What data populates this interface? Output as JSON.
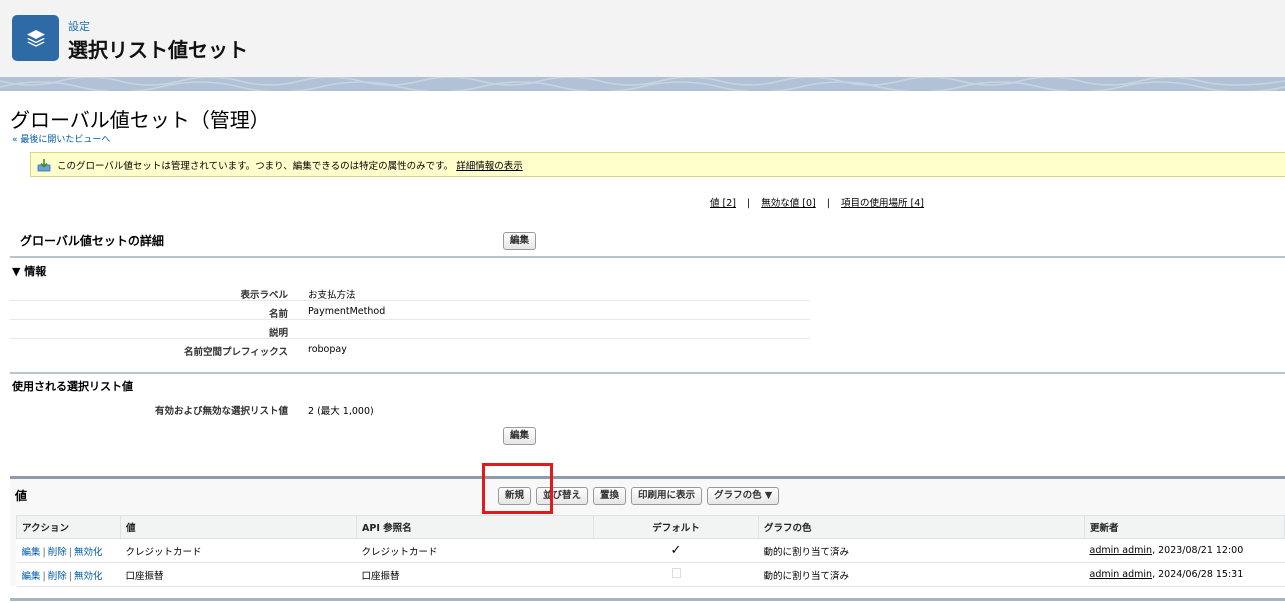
{
  "header": {
    "subtitle": "設定",
    "title": "選択リスト値セット",
    "icon": "stack-layers-icon"
  },
  "page": {
    "title": "グローバル値セット（管理）",
    "back_link": "« 最後に開いたビューへ"
  },
  "info_bar": {
    "text": "このグローバル値セットは管理されています。つまり、編集できるのは特定の属性のみです。",
    "link": "詳細情報の表示"
  },
  "related_links": [
    {
      "label": "値 [2]"
    },
    {
      "label": "無効な値 [0]"
    },
    {
      "label": "項目の使用場所 [4]"
    }
  ],
  "related_sep": "|",
  "detail": {
    "heading": "グローバル値セットの詳細",
    "edit_label": "編集",
    "section_label": "▼ 情報",
    "fields": [
      {
        "label": "表示ラベル",
        "value": "お支払方法"
      },
      {
        "label": "名前",
        "value": "PaymentMethod"
      },
      {
        "label": "説明",
        "value": ""
      },
      {
        "label": "名前空間プレフィックス",
        "value": "robopay"
      }
    ]
  },
  "used": {
    "heading": "使用される選択リスト値",
    "label": "有効および無効な選択リスト値",
    "value": "2 (最大 1,000)",
    "edit_label": "編集"
  },
  "values": {
    "title": "値",
    "buttons": {
      "new": "新規",
      "sort": "並び替え",
      "replace": "置換",
      "print": "印刷用に表示",
      "chart_color": "グラフの色 ▼"
    },
    "columns": [
      "アクション",
      "値",
      "API 参照名",
      "デフォルト",
      "グラフの色",
      "更新者"
    ],
    "action_labels": {
      "edit": "編集",
      "delete": "削除",
      "deactivate": "無効化",
      "sep": "|"
    },
    "rows": [
      {
        "value": "クレジットカード",
        "api_name": "クレジットカード",
        "default": "✓",
        "chart_color": "動的に割り当て済み",
        "modified_by": "admin admin",
        "modified_at": ", 2023/08/21 12:00"
      },
      {
        "value": "口座振替",
        "api_name": "口座振替",
        "default": "",
        "chart_color": "動的に割り当て済み",
        "modified_by": "admin admin",
        "modified_at": ", 2024/06/28 15:31"
      }
    ]
  }
}
